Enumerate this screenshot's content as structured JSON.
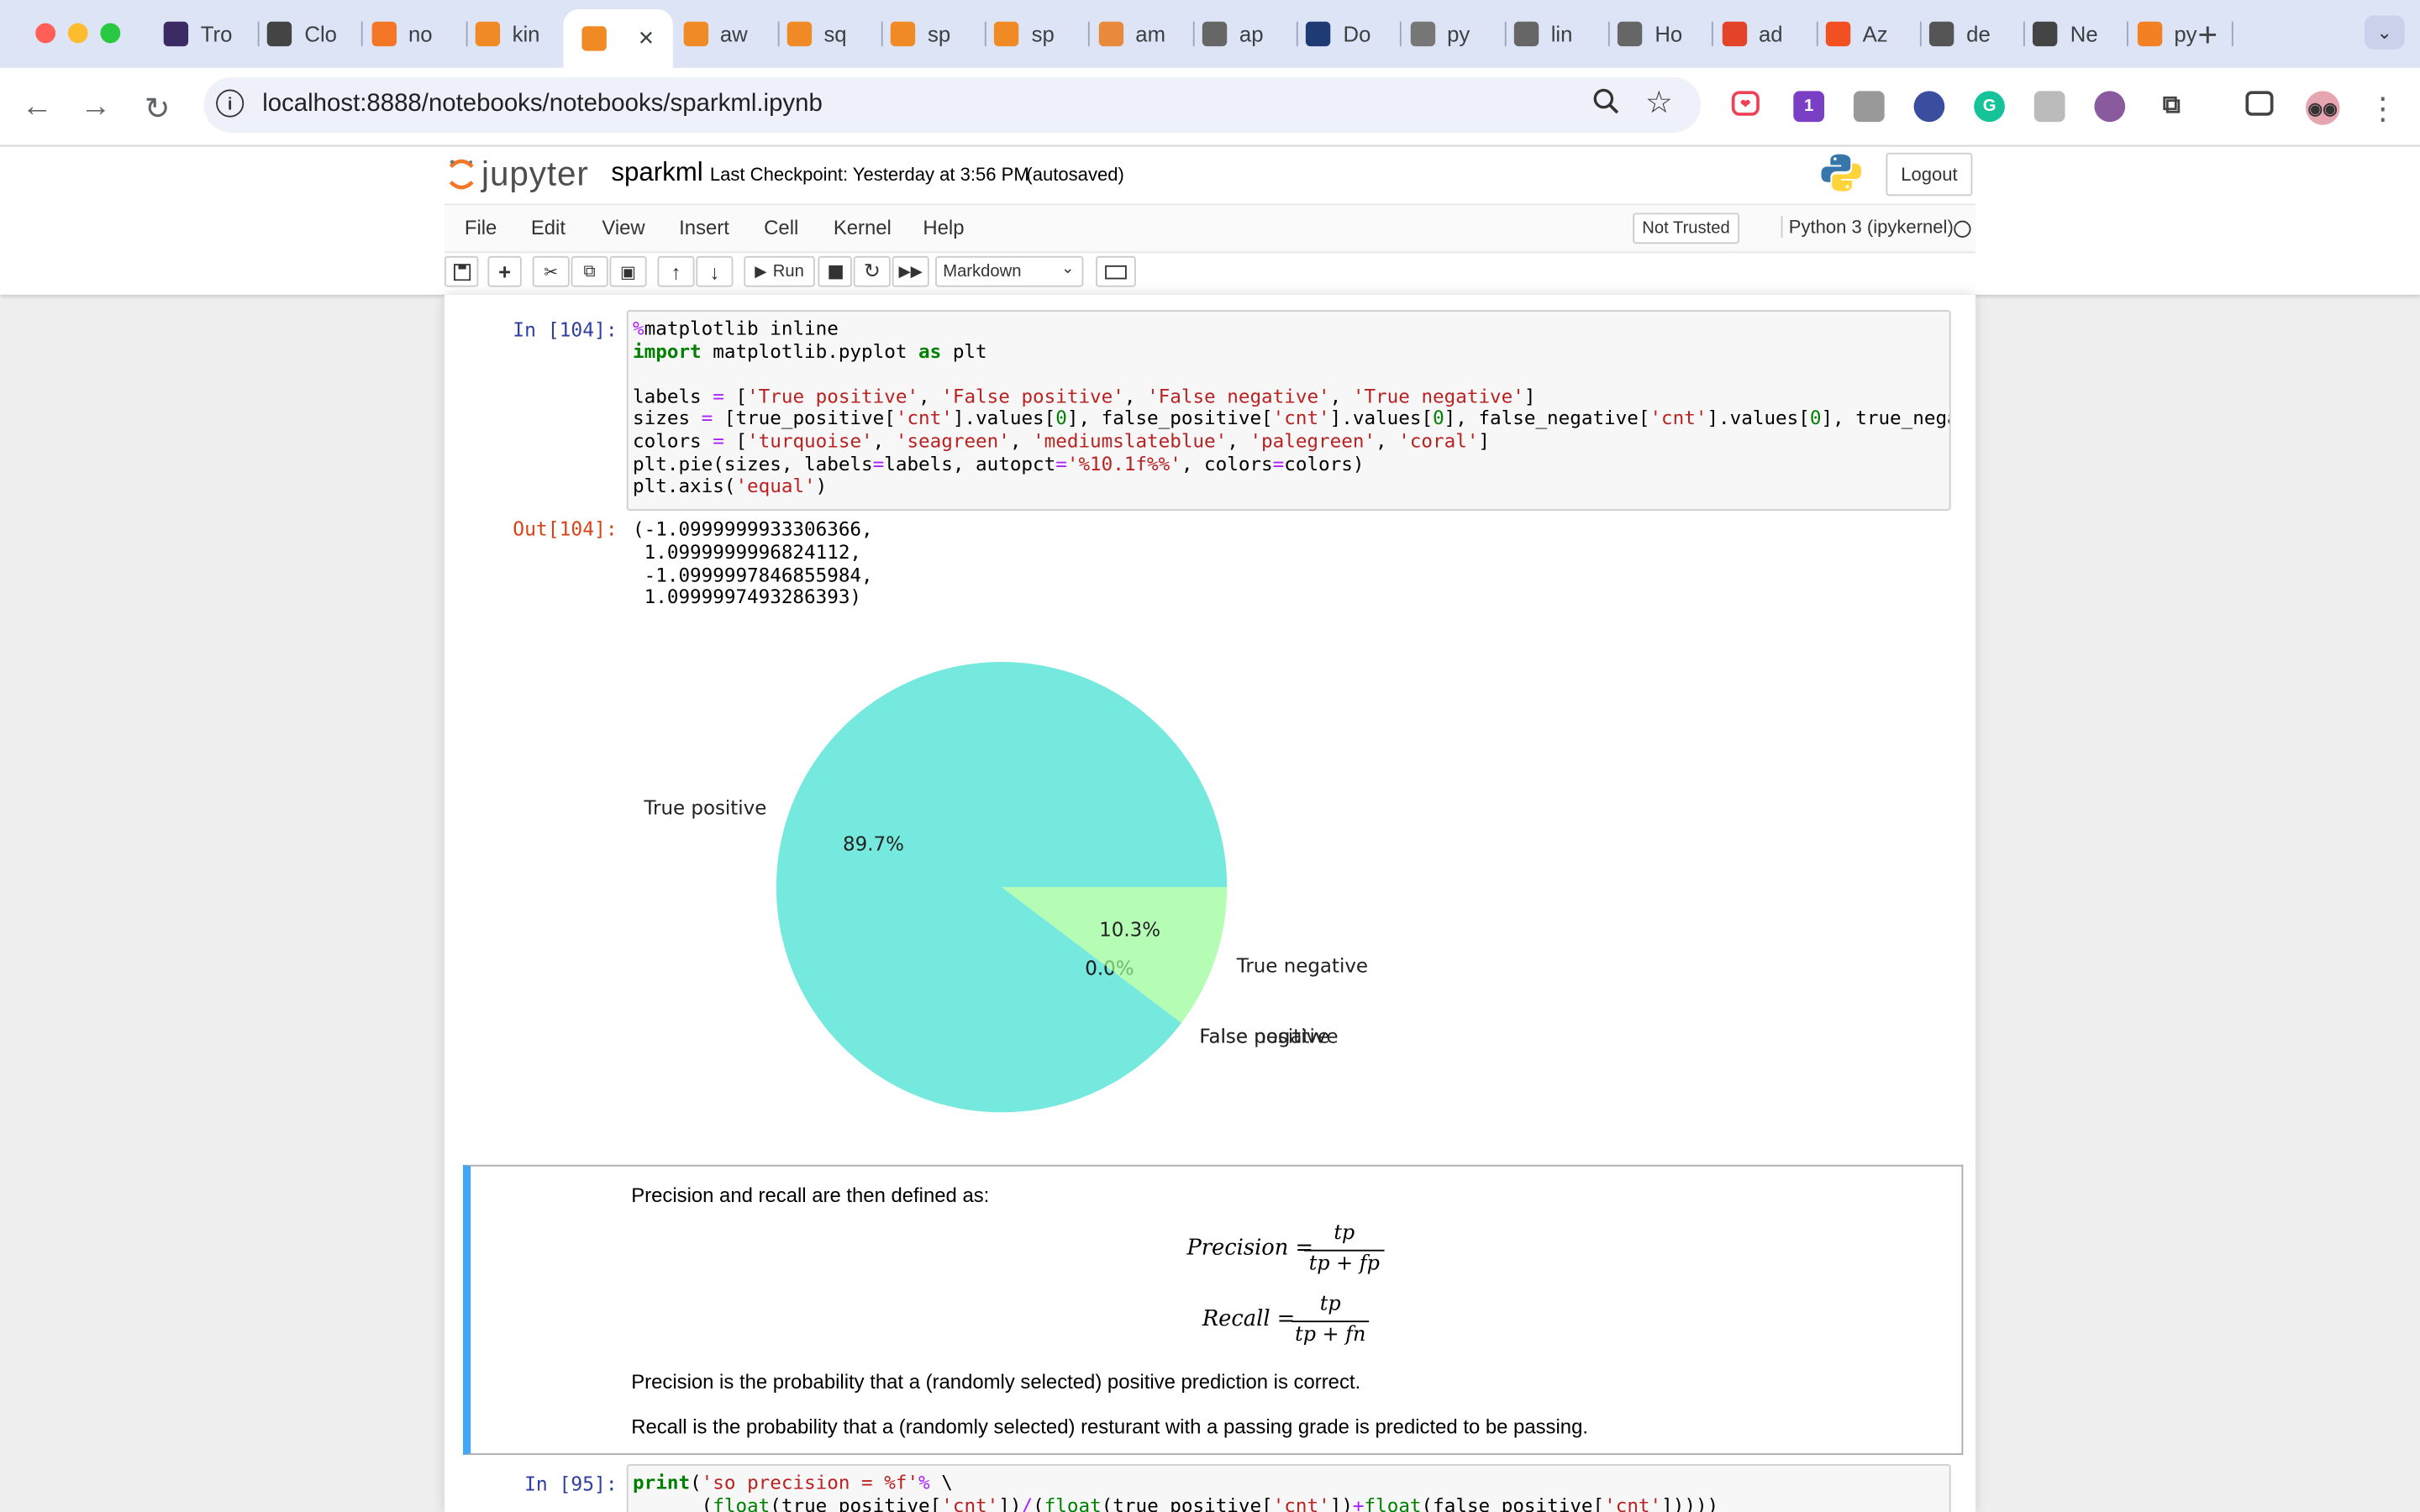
{
  "browser": {
    "tabs": [
      "Tro",
      "Clo",
      "no",
      "kin",
      "",
      "aw",
      "sq",
      "sp",
      "sp",
      "am",
      "ap",
      "Do",
      "py",
      "lin",
      "Ho",
      "ad",
      "Az",
      "de",
      "Ne",
      "py"
    ],
    "url": "localhost:8888/notebooks/notebooks/sparkml.ipynb",
    "extension_badge": "1"
  },
  "jupyter": {
    "logo_text": "jupyter",
    "notebook_name": "sparkml",
    "checkpoint": "Last Checkpoint: Yesterday at 3:56 PM",
    "autosaved": "(autosaved)",
    "logout": "Logout",
    "menu": [
      "File",
      "Edit",
      "View",
      "Insert",
      "Cell",
      "Kernel",
      "Help"
    ],
    "trust": "Not Trusted",
    "kernel": "Python 3 (ipykernel)",
    "run_label": "Run",
    "cell_type": "Markdown"
  },
  "cells": {
    "cell1_prompt": "In [104]:",
    "cell1_out_prompt": "Out[104]:",
    "cell1_code": [
      "%matplotlib inline",
      "import matplotlib.pyplot as plt",
      "",
      "labels = ['True positive', 'False positive', 'False negative', 'True negative']",
      "sizes = [true_positive['cnt'].values[0], false_positive['cnt'].values[0], false_negative['cnt'].values[0], true_nega",
      "colors = ['turquoise', 'seagreen', 'mediumslateblue', 'palegreen', 'coral']",
      "plt.pie(sizes, labels=labels, autopct='%10.1f%%', colors=colors)",
      "plt.axis('equal')"
    ],
    "cell1_output": "(-1.0999999933306366,\n 1.0999999996824112,\n -1.0999997846855984,\n 1.0999997493286393)",
    "md_intro": "Precision and recall are then defined as:",
    "precision_lhs": "Precision =",
    "precision_num": "tp",
    "precision_den": "tp + fp",
    "recall_lhs": "Recall =",
    "recall_num": "tp",
    "recall_den": "tp + fn",
    "md_precision": "Precision is the probability that a (randomly selected) positive prediction is correct.",
    "md_recall": "Recall is the probability that a (randomly selected) resturant with a passing grade is predicted to be passing.",
    "cell2_prompt": "In [95]:",
    "cell2_code": [
      "print('so precision = %f'% \\",
      "      (float(true_positive['cnt'])/(float(true_positive['cnt'])+float(false_positive['cnt']))))"
    ]
  },
  "chart_data": {
    "type": "pie",
    "slices": [
      {
        "label": "True positive",
        "value": 89.7,
        "pct_label": "89.7%",
        "color": "#40e0d0"
      },
      {
        "label": "False positive",
        "value": 0.0,
        "pct_label": "0.0%",
        "color": "#2e8b57"
      },
      {
        "label": "False negative",
        "value": 0.0,
        "pct_label": "0.0%",
        "color": "#7b68ee"
      },
      {
        "label": "True negative",
        "value": 10.3,
        "pct_label": "10.3%",
        "color": "#98fb98"
      }
    ],
    "start_angle_deg": 0,
    "direction": "counterclockwise",
    "alpha": 0.72
  }
}
